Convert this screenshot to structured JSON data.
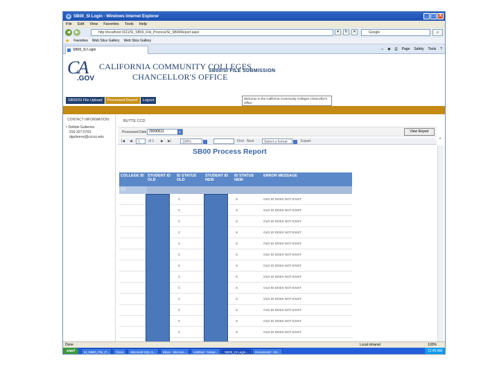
{
  "window": {
    "title": "SB00_SI Login - Windows Internet Explorer",
    "minimize": "_",
    "maximize": "□",
    "close": "X"
  },
  "menu": [
    "File",
    "Edit",
    "View",
    "Favorites",
    "Tools",
    "Help"
  ],
  "address": {
    "url": "http://localhost:1611/SI_SB00_File_Process/SI_SB00Report.aspx",
    "search_placeholder": "Google"
  },
  "favorites": {
    "label": "Favorites",
    "links": [
      "Web Slice Gallery",
      "Web Slice Gallery"
    ]
  },
  "tab": {
    "label": "SB00_SI Login"
  },
  "command_bar": [
    "Page",
    "Safety",
    "Tools"
  ],
  "header": {
    "logo_ca": "CA",
    "logo_gov": ".GOV",
    "org_line1": "CALIFORNIA COMMUNITY COLLEGES",
    "org_line2": "CHANCELLOR'S OFFICE",
    "app_title": "SB00/SI FILE SUBMISSION",
    "welcome": "Welcome to the California Community Colleges Chancellor's Office"
  },
  "nav": [
    {
      "label": "SB00/SI File Upload"
    },
    {
      "label": "Processed Report"
    },
    {
      "label": "Logout"
    }
  ],
  "sidebar": {
    "contact_header": "CONTACT INFORMATION:",
    "name": "Debbie Gutierrez",
    "phone": "916-327-5703",
    "email": "dgutierrez@cccco.edu"
  },
  "main": {
    "college": "BUTTE CCD",
    "processed_date_label": "Processed Date:",
    "processed_date_value": "20090611",
    "view_report": "View Report",
    "toolbar": {
      "page": "1",
      "of": "of 1",
      "zoom": "100%",
      "find": "Find",
      "next": "Next",
      "format": "Select a format",
      "export": "Export"
    }
  },
  "report": {
    "title": "SB00 Process Report",
    "columns": [
      "COLLEGE ID",
      "STUDENT ID OLD",
      "ID STATUS OLD",
      "STUDENT ID NEW",
      "ID STATUS NEW",
      "ERROR MESSAGE"
    ],
    "group_value": "111",
    "rows": [
      {
        "status_old": "C",
        "status_new": "S",
        "error": "OLD ID DOES NOT EXIST"
      },
      {
        "status_old": "C",
        "status_new": "S",
        "error": "OLD ID DOES NOT EXIST"
      },
      {
        "status_old": "C",
        "status_new": "S",
        "error": "OLD ID DOES NOT EXIST"
      },
      {
        "status_old": "C",
        "status_new": "S",
        "error": "OLD ID DOES NOT EXIST"
      },
      {
        "status_old": "C",
        "status_new": "S",
        "error": "OLD ID DOES NOT EXIST"
      },
      {
        "status_old": "C",
        "status_new": "S",
        "error": "OLD ID DOES NOT EXIST"
      },
      {
        "status_old": "C",
        "status_new": "S",
        "error": "OLD ID DOES NOT EXIST"
      },
      {
        "status_old": "C",
        "status_new": "S",
        "error": "OLD ID DOES NOT EXIST"
      },
      {
        "status_old": "C",
        "status_new": "S",
        "error": "OLD ID DOES NOT EXIST"
      },
      {
        "status_old": "C",
        "status_new": "S",
        "error": "OLD ID DOES NOT EXIST"
      },
      {
        "status_old": "C",
        "status_new": "S",
        "error": "OLD ID DOES NOT EXIST"
      },
      {
        "status_old": "C",
        "status_new": "S",
        "error": "OLD ID DOES NOT EXIST"
      },
      {
        "status_old": "C",
        "status_new": "S",
        "error": "OLD ID DOES NOT EXIST"
      },
      {
        "status_old": "C",
        "status_new": "S",
        "error": "OLD ID DOES NOT EXIST"
      }
    ]
  },
  "status": {
    "text": "Done",
    "zone": "Local intranet",
    "zoom": "100%"
  },
  "taskbar": {
    "start": "start",
    "items": [
      "SI_SB00_File_P...",
      "Cisco",
      "Microsoft SQL S...",
      "Inbox - Microso...",
      "Untitled - Notep...",
      "SB00_SI Login...",
      "Document2 - Mi..."
    ],
    "clock": "11:45 AM"
  },
  "colors": {
    "navy": "#1e3e6e",
    "gold": "#c48a13",
    "report_blue": "#5b88c8"
  }
}
